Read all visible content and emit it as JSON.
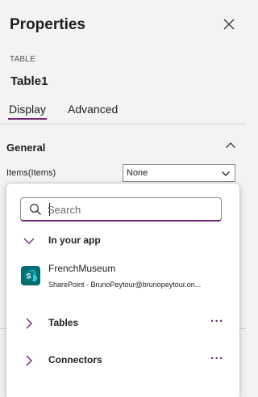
{
  "panel": {
    "title": "Properties",
    "control_type_label": "TABLE",
    "control_name": "Table1",
    "tabs": [
      {
        "label": "Display",
        "active": true
      },
      {
        "label": "Advanced",
        "active": false
      }
    ],
    "section_title": "General",
    "property": {
      "label": "Items(Items)",
      "value": "None"
    }
  },
  "flyout": {
    "search": {
      "placeholder": "Search",
      "value": ""
    },
    "in_your_app": {
      "label": "In your app",
      "expanded": true
    },
    "data_source": {
      "icon": "sharepoint-icon",
      "name": "FrenchMuseum",
      "description": "SharePoint - BrunoPeytour@brunopeytour.on..."
    },
    "groups": [
      {
        "label": "Tables",
        "more": "···"
      },
      {
        "label": "Connectors",
        "more": "···"
      }
    ]
  },
  "colors": {
    "accent": "#742774",
    "sharepoint_teal": "#036c70",
    "panel_bg": "#f3f3f3"
  },
  "icons": {
    "close": "close-icon",
    "collapse": "chevron-up-icon",
    "dropdown": "chevron-down-icon",
    "search": "search-icon",
    "expanded_group": "chevron-down-icon",
    "collapsed_group": "chevron-right-icon"
  }
}
